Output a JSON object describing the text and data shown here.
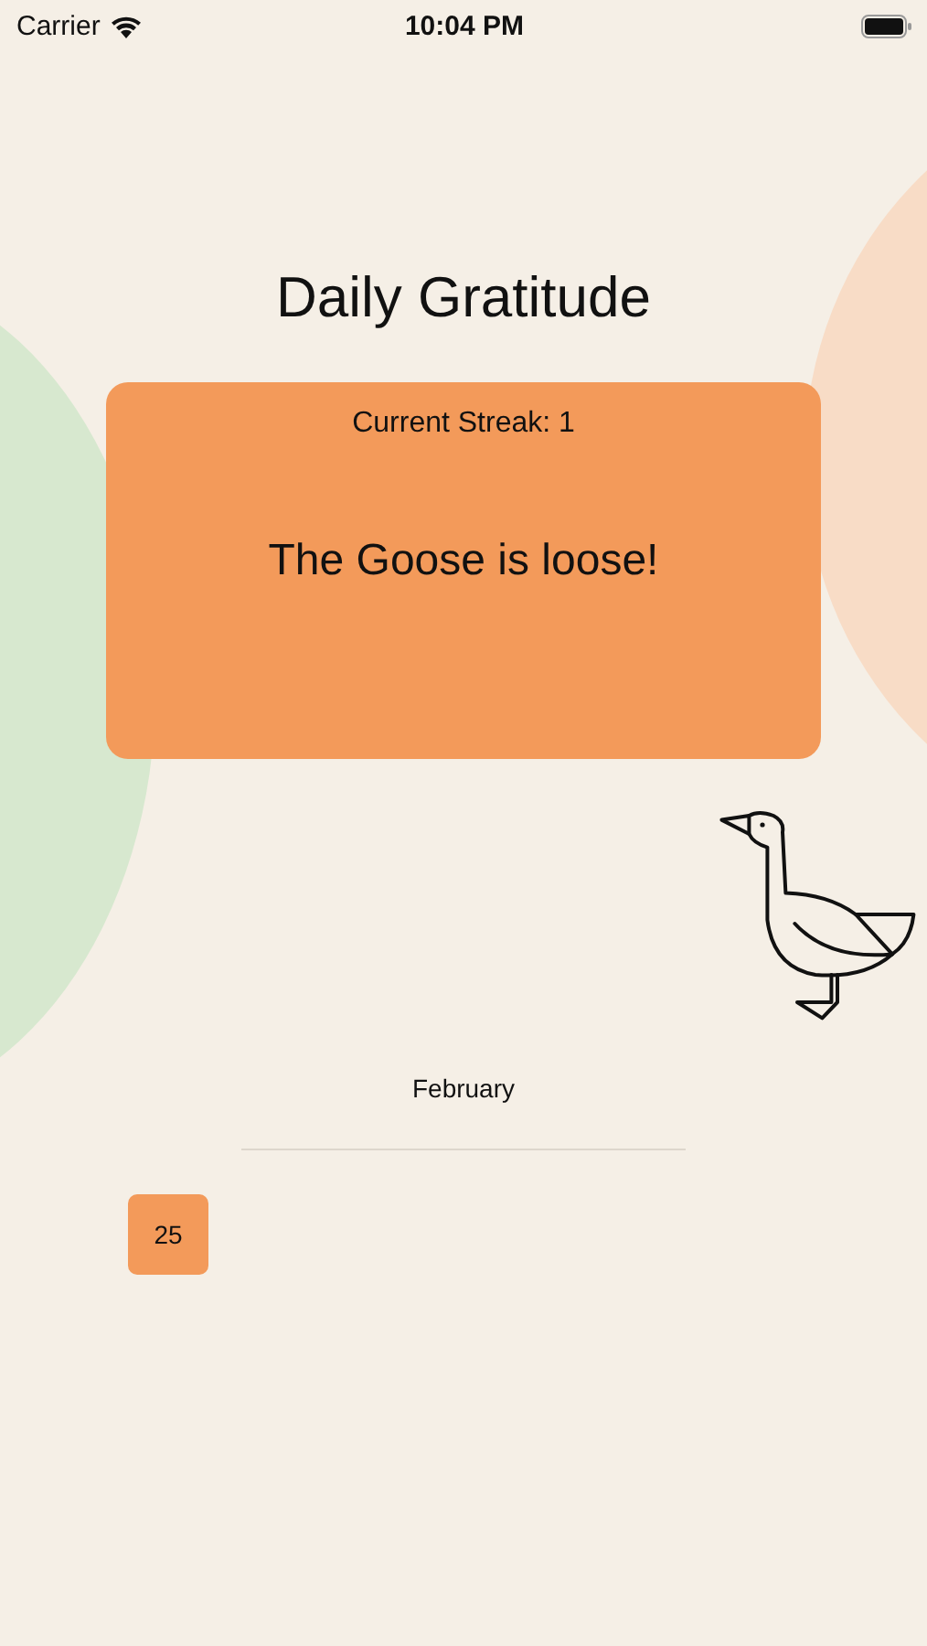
{
  "status_bar": {
    "carrier": "Carrier",
    "time": "10:04 PM"
  },
  "title": "Daily Gratitude",
  "streak_card": {
    "streak": "Current Streak: 1",
    "message": "The Goose is loose!"
  },
  "calendar": {
    "month": "February",
    "days": [
      {
        "label": "25"
      }
    ]
  }
}
